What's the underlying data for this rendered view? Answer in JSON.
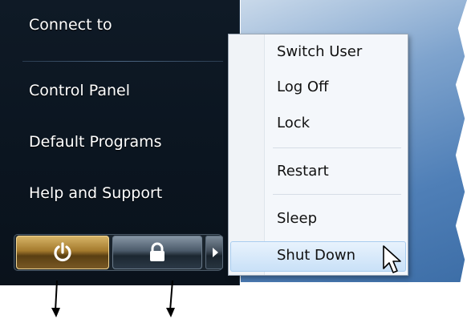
{
  "start_menu": {
    "items": [
      {
        "label": "Connect to"
      },
      {
        "label": "Control Panel"
      },
      {
        "label": "Default Programs"
      },
      {
        "label": "Help and Support"
      }
    ]
  },
  "buttons": {
    "power_icon": "power-icon",
    "lock_icon": "lock-icon",
    "arrow_icon": "chevron-right-icon"
  },
  "context_menu": {
    "items": [
      {
        "label": "Switch User"
      },
      {
        "label": "Log Off"
      },
      {
        "label": "Lock"
      },
      {
        "label": "Restart"
      },
      {
        "label": "Sleep"
      },
      {
        "label": "Shut Down"
      }
    ],
    "highlighted": "Shut Down"
  },
  "colors": {
    "power_button": "#a47a2d",
    "menu_bg": "#0b1520",
    "highlight": "#c8e0f7"
  }
}
